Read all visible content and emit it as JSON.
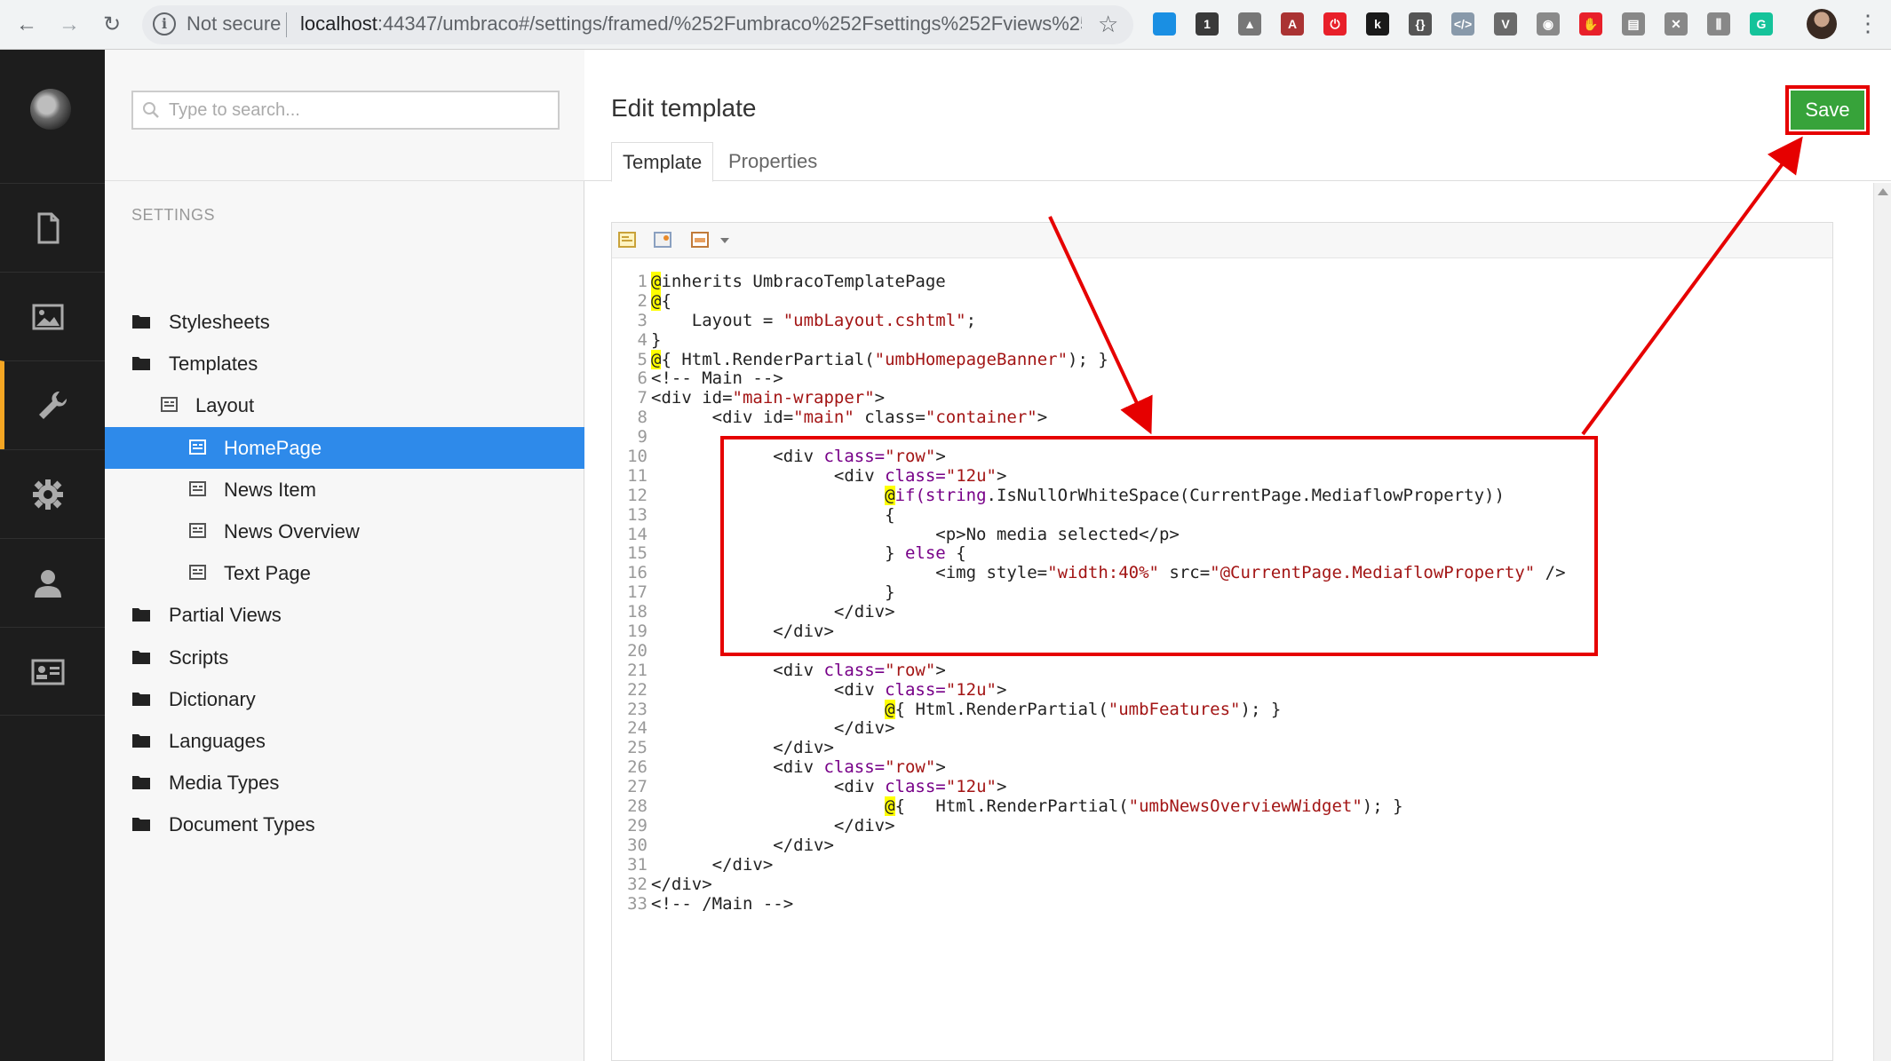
{
  "browser": {
    "security": "Not secure",
    "url_host": "localhost",
    "url_rest": ":44347/umbraco#/settings/framed/%252Fumbraco%252Fsettings%252Fviews%252F...",
    "back_icon": "back-arrow-icon",
    "forward_icon": "forward-arrow-icon",
    "reload_icon": "reload-icon",
    "star_icon": "bookmark-star-icon",
    "extensions": [
      {
        "name": "ext-blue-window-icon",
        "glyph": "",
        "color": "#1a8fe3"
      },
      {
        "name": "ext-1password-icon",
        "glyph": "1",
        "color": "#3a3a3a"
      },
      {
        "name": "ext-drive-icon",
        "glyph": "▲",
        "color": "#777777"
      },
      {
        "name": "ext-pdf-icon",
        "glyph": "A",
        "color": "#a33"
      },
      {
        "name": "ext-power-icon",
        "glyph": "⏻",
        "color": "#e8202a"
      },
      {
        "name": "ext-k-icon",
        "glyph": "k",
        "color": "#1a1a1a"
      },
      {
        "name": "ext-json-icon",
        "glyph": "{}",
        "color": "#555555"
      },
      {
        "name": "ext-code-icon",
        "glyph": "</>",
        "color": "#8899aa"
      },
      {
        "name": "ext-vue-icon",
        "glyph": "V",
        "color": "#6a6a6a"
      },
      {
        "name": "ext-camera-icon",
        "glyph": "◉",
        "color": "#8a8a8a"
      },
      {
        "name": "ext-hand-icon",
        "glyph": "✋",
        "color": "#e8202a"
      },
      {
        "name": "ext-ticket-icon",
        "glyph": "▤",
        "color": "#888888"
      },
      {
        "name": "ext-tools-icon",
        "glyph": "✕",
        "color": "#888888"
      },
      {
        "name": "ext-bars-icon",
        "glyph": "⫼",
        "color": "#888888"
      },
      {
        "name": "ext-grammarly-icon",
        "glyph": "G",
        "color": "#15c39a"
      }
    ]
  },
  "appbar": {
    "sections": [
      {
        "name": "content-section-icon",
        "active": false
      },
      {
        "name": "media-section-icon",
        "active": false
      },
      {
        "name": "settings-section-icon",
        "active": true
      },
      {
        "name": "developer-section-icon",
        "active": false
      },
      {
        "name": "users-section-icon",
        "active": false
      },
      {
        "name": "members-section-icon",
        "active": false
      }
    ]
  },
  "tree": {
    "search_placeholder": "Type to search...",
    "heading": "SETTINGS",
    "items": [
      {
        "label": "Stylesheets",
        "icon": "folder-icon",
        "level": 0
      },
      {
        "label": "Templates",
        "icon": "folder-icon",
        "level": 0
      },
      {
        "label": "Layout",
        "icon": "template-icon",
        "level": 1
      },
      {
        "label": "HomePage",
        "icon": "template-icon",
        "level": 2,
        "selected": true
      },
      {
        "label": "News Item",
        "icon": "template-icon",
        "level": 2
      },
      {
        "label": "News Overview",
        "icon": "template-icon",
        "level": 2
      },
      {
        "label": "Text Page",
        "icon": "template-icon",
        "level": 2
      },
      {
        "label": "Partial Views",
        "icon": "folder-icon",
        "level": 0
      },
      {
        "label": "Scripts",
        "icon": "folder-icon",
        "level": 0
      },
      {
        "label": "Dictionary",
        "icon": "folder-icon",
        "level": 0
      },
      {
        "label": "Languages",
        "icon": "folder-icon",
        "level": 0
      },
      {
        "label": "Media Types",
        "icon": "folder-icon",
        "level": 0
      },
      {
        "label": "Document Types",
        "icon": "folder-icon",
        "level": 0
      }
    ]
  },
  "editor": {
    "title": "Edit template",
    "save_label": "Save",
    "tabs": [
      {
        "label": "Template",
        "active": true
      },
      {
        "label": "Properties",
        "active": false
      }
    ],
    "toolbar": [
      {
        "name": "insert-macro-icon"
      },
      {
        "name": "insert-value-icon"
      },
      {
        "name": "insert-partial-icon"
      },
      {
        "name": "more-dropdown-icon"
      }
    ],
    "code": [
      [
        {
          "t": "@",
          "c": "at"
        },
        {
          "t": "inherits UmbracoTemplatePage",
          "c": "p"
        }
      ],
      [
        {
          "t": "@",
          "c": "at"
        },
        {
          "t": "{",
          "c": "p"
        }
      ],
      [
        {
          "t": "    Layout = ",
          "c": "p"
        },
        {
          "t": "\"umbLayout.cshtml\"",
          "c": "s"
        },
        {
          "t": ";",
          "c": "p"
        }
      ],
      [
        {
          "t": "}",
          "c": "p"
        }
      ],
      [
        {
          "t": "@",
          "c": "at"
        },
        {
          "t": "{ Html.RenderPartial(",
          "c": "p"
        },
        {
          "t": "\"umbHomepageBanner\"",
          "c": "s"
        },
        {
          "t": "); }",
          "c": "p"
        }
      ],
      [
        {
          "t": "<!-- Main -->",
          "c": "p"
        }
      ],
      [
        {
          "t": "<div id=",
          "c": "p"
        },
        {
          "t": "\"main-wrapper\"",
          "c": "s"
        },
        {
          "t": ">",
          "c": "p"
        }
      ],
      [
        {
          "t": "      <div id=",
          "c": "p"
        },
        {
          "t": "\"main\"",
          "c": "s"
        },
        {
          "t": " class=",
          "c": "p"
        },
        {
          "t": "\"container\"",
          "c": "s"
        },
        {
          "t": ">",
          "c": "p"
        }
      ],
      [
        {
          "t": "",
          "c": "p"
        }
      ],
      [
        {
          "t": "            <div ",
          "c": "p"
        },
        {
          "t": "class=",
          "c": "k"
        },
        {
          "t": "\"row\"",
          "c": "s"
        },
        {
          "t": ">",
          "c": "p"
        }
      ],
      [
        {
          "t": "                  <div ",
          "c": "p"
        },
        {
          "t": "class=",
          "c": "k"
        },
        {
          "t": "\"12u\"",
          "c": "s"
        },
        {
          "t": ">",
          "c": "p"
        }
      ],
      [
        {
          "t": "                       ",
          "c": "p"
        },
        {
          "t": "@",
          "c": "at"
        },
        {
          "t": "if(",
          "c": "k"
        },
        {
          "t": "string",
          "c": "k"
        },
        {
          "t": ".IsNullOrWhiteSpace(CurrentPage.MediaflowProperty))",
          "c": "p"
        }
      ],
      [
        {
          "t": "                       {",
          "c": "p"
        }
      ],
      [
        {
          "t": "                            <p>No media selected</p>",
          "c": "p"
        }
      ],
      [
        {
          "t": "                       } ",
          "c": "p"
        },
        {
          "t": "else",
          "c": "k"
        },
        {
          "t": " {",
          "c": "p"
        }
      ],
      [
        {
          "t": "                            <img style=",
          "c": "p"
        },
        {
          "t": "\"width:40%\"",
          "c": "s"
        },
        {
          "t": " src=",
          "c": "p"
        },
        {
          "t": "\"@CurrentPage.MediaflowProperty\"",
          "c": "s"
        },
        {
          "t": " />",
          "c": "p"
        }
      ],
      [
        {
          "t": "                       }",
          "c": "p"
        }
      ],
      [
        {
          "t": "                  </div>",
          "c": "p"
        }
      ],
      [
        {
          "t": "            </div>",
          "c": "p"
        }
      ],
      [
        {
          "t": "",
          "c": "p"
        }
      ],
      [
        {
          "t": "            <div ",
          "c": "p"
        },
        {
          "t": "class=",
          "c": "k"
        },
        {
          "t": "\"row\"",
          "c": "s"
        },
        {
          "t": ">",
          "c": "p"
        }
      ],
      [
        {
          "t": "                  <div ",
          "c": "p"
        },
        {
          "t": "class=",
          "c": "k"
        },
        {
          "t": "\"12u\"",
          "c": "s"
        },
        {
          "t": ">",
          "c": "p"
        }
      ],
      [
        {
          "t": "                       ",
          "c": "p"
        },
        {
          "t": "@",
          "c": "at"
        },
        {
          "t": "{ Html.RenderPartial(",
          "c": "p"
        },
        {
          "t": "\"umbFeatures\"",
          "c": "s"
        },
        {
          "t": "); }",
          "c": "p"
        }
      ],
      [
        {
          "t": "                  </div>",
          "c": "p"
        }
      ],
      [
        {
          "t": "            </div>",
          "c": "p"
        }
      ],
      [
        {
          "t": "            <div ",
          "c": "p"
        },
        {
          "t": "class=",
          "c": "k"
        },
        {
          "t": "\"row\"",
          "c": "s"
        },
        {
          "t": ">",
          "c": "p"
        }
      ],
      [
        {
          "t": "                  <div ",
          "c": "p"
        },
        {
          "t": "class=",
          "c": "k"
        },
        {
          "t": "\"12u\"",
          "c": "s"
        },
        {
          "t": ">",
          "c": "p"
        }
      ],
      [
        {
          "t": "                       ",
          "c": "p"
        },
        {
          "t": "@",
          "c": "at"
        },
        {
          "t": "{   Html.RenderPartial(",
          "c": "p"
        },
        {
          "t": "\"umbNewsOverviewWidget\"",
          "c": "s"
        },
        {
          "t": "); }",
          "c": "p"
        }
      ],
      [
        {
          "t": "                  </div>",
          "c": "p"
        }
      ],
      [
        {
          "t": "            </div>",
          "c": "p"
        }
      ],
      [
        {
          "t": "      </div>",
          "c": "p"
        }
      ],
      [
        {
          "t": "</div>",
          "c": "p"
        }
      ],
      [
        {
          "t": "<!-- /Main -->",
          "c": "p"
        }
      ]
    ]
  },
  "colors": {
    "accent_selected": "#2e8aea",
    "save_green": "#37a33a",
    "annotation_red": "#e60000",
    "code_string": "#a31515",
    "code_keyword": "#770088",
    "code_at_highlight": "#ffff00"
  }
}
